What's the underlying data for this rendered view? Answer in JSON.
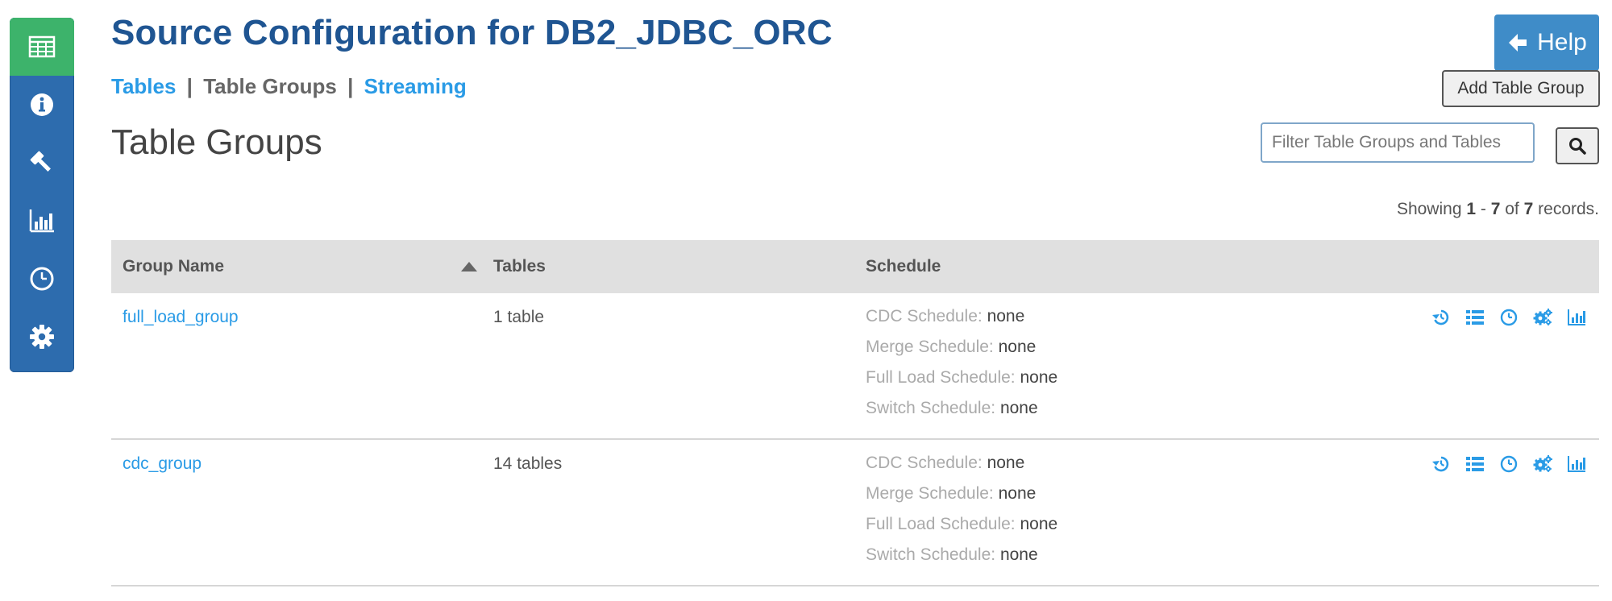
{
  "sidebar": {
    "items": [
      {
        "icon": "table-icon",
        "active": true
      },
      {
        "icon": "info-icon",
        "active": false
      },
      {
        "icon": "gavel-icon",
        "active": false
      },
      {
        "icon": "bar-chart-icon",
        "active": false
      },
      {
        "icon": "clock-icon",
        "active": false
      },
      {
        "icon": "gear-icon",
        "active": false
      }
    ]
  },
  "header": {
    "title": "Source Configuration for DB2_JDBC_ORC",
    "help_label": "Help",
    "add_table_group_label": "Add Table Group"
  },
  "subnav": {
    "tables": "Tables",
    "sep1": "|",
    "table_groups": "Table Groups",
    "sep2": "|",
    "streaming": "Streaming"
  },
  "section": {
    "title": "Table Groups",
    "filter_placeholder": "Filter Table Groups and Tables"
  },
  "records": {
    "prefix": "Showing",
    "from": "1",
    "dash": "-",
    "to": "7",
    "of": "of",
    "total": "7",
    "suffix": "records."
  },
  "table": {
    "columns": [
      "Group Name",
      "Tables",
      "Schedule"
    ],
    "sort_column": "Group Name",
    "rows": [
      {
        "name": "full_load_group",
        "tables": "1 table",
        "schedule": [
          {
            "label": "CDC Schedule:",
            "value": "none"
          },
          {
            "label": "Merge Schedule:",
            "value": "none"
          },
          {
            "label": "Full Load Schedule:",
            "value": "none"
          },
          {
            "label": "Switch Schedule:",
            "value": "none"
          }
        ]
      },
      {
        "name": "cdc_group",
        "tables": "14 tables",
        "schedule": [
          {
            "label": "CDC Schedule:",
            "value": "none"
          },
          {
            "label": "Merge Schedule:",
            "value": "none"
          },
          {
            "label": "Full Load Schedule:",
            "value": "none"
          },
          {
            "label": "Switch Schedule:",
            "value": "none"
          }
        ]
      }
    ],
    "row_actions": [
      "history-icon",
      "list-icon",
      "clock-icon",
      "cogs-icon",
      "bar-chart-icon"
    ]
  },
  "colors": {
    "sidebar": "#2d6cae",
    "sidebar_active": "#3db36b",
    "title": "#1f5592",
    "link": "#2a9be6",
    "help_button": "#3f8cc8"
  }
}
